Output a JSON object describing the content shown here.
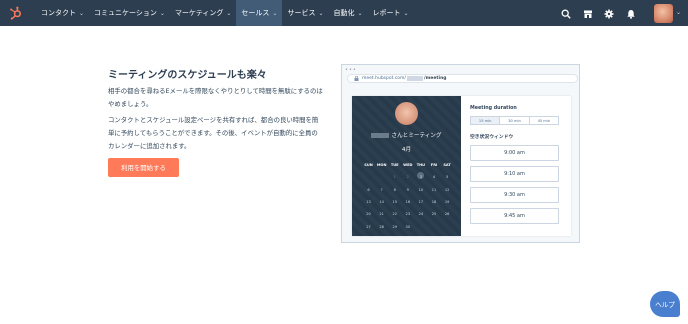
{
  "nav": {
    "items": [
      {
        "label": "コンタクト"
      },
      {
        "label": "コミュニケーション"
      },
      {
        "label": "マーケティング"
      },
      {
        "label": "セールス"
      },
      {
        "label": "サービス"
      },
      {
        "label": "自動化"
      },
      {
        "label": "レポート"
      }
    ],
    "active_index": 3,
    "icons": [
      "search-icon",
      "marketplace-icon",
      "settings-gear-icon",
      "notifications-bell-icon"
    ]
  },
  "main": {
    "title": "ミーティングのスケジュールも楽々",
    "paragraph1": "相手の都合を尋ねるEメールを際限なくやりとりして時間を無駄にするのはやめましょう。",
    "paragraph2": "コンタクトとスケジュール設定ページを共有すれば、都合の良い時間を簡単に予約してもらうことができます。その後、イベントが自動的に全員のカレンダーに追加されます。",
    "start_button": "利用を開始する"
  },
  "preview": {
    "url_prefix": "meet.hubspot.com/",
    "url_suffix": "/meeting",
    "meeting_name": "さんとミーティング",
    "month": "4月",
    "weekdays": [
      "SUN",
      "MON",
      "TUE",
      "WED",
      "THU",
      "FRI",
      "SAT"
    ],
    "weeks": [
      [
        "",
        "",
        "1",
        "2",
        "3",
        "4",
        "5"
      ],
      [
        "6",
        "7",
        "8",
        "9",
        "10",
        "11",
        "12"
      ],
      [
        "13",
        "14",
        "15",
        "16",
        "17",
        "18",
        "19"
      ],
      [
        "20",
        "21",
        "22",
        "23",
        "24",
        "25",
        "26"
      ],
      [
        "27",
        "28",
        "29",
        "30",
        "",
        "",
        ""
      ]
    ],
    "today": "3",
    "duration_label": "Meeting duration",
    "durations": [
      "15 min",
      "30 min",
      "45 min"
    ],
    "selected_duration": 0,
    "availability_label": "空き状況ウィンドウ",
    "slots": [
      "9:00 am",
      "9:10 am",
      "9:30 am",
      "9:45 am"
    ]
  },
  "help_button": "ヘルプ",
  "colors": {
    "nav_bg": "#2d3e50",
    "accent": "#ff7a59",
    "help": "#4a7fd0",
    "calendar_bg": "#273a4b"
  }
}
